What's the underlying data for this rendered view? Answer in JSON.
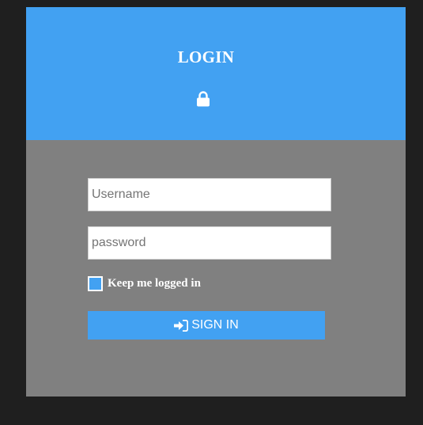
{
  "header": {
    "title": "LOGIN",
    "icon": "lock-icon"
  },
  "form": {
    "username_placeholder": "Username",
    "password_placeholder": "password",
    "remember_label": "Keep me logged in",
    "remember_checked": false,
    "submit_label": "SIGN IN",
    "submit_icon": "sign-in-icon"
  },
  "colors": {
    "accent": "#42a1f2",
    "card_background": "#808080",
    "page_background": "#1f1f1f"
  }
}
